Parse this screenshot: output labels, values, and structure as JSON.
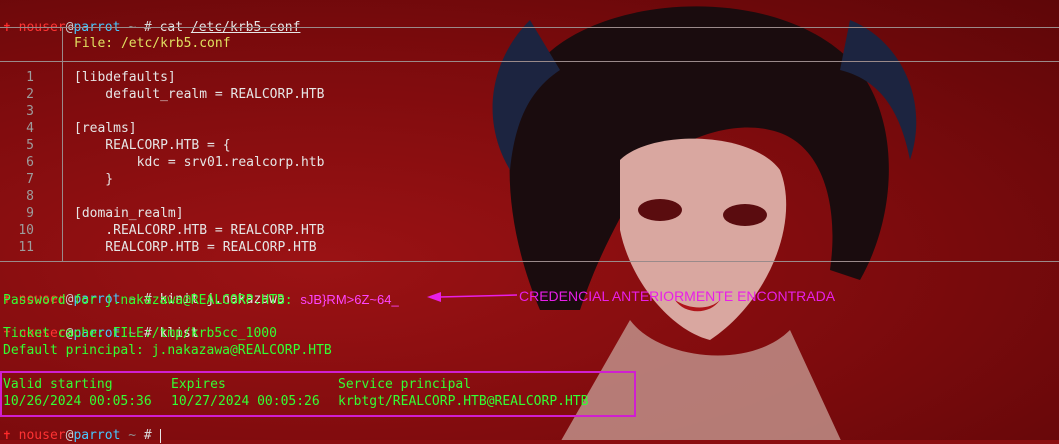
{
  "prompt": {
    "cross": "✝",
    "user": "nouser",
    "at": "@",
    "host": "parrot",
    "path": "~",
    "symbol": "#"
  },
  "commands": {
    "cat": "cat",
    "cat_arg": "/etc/krb5.conf",
    "kinit": "kinit j.nakazawa",
    "klist": "klist"
  },
  "file_header": "File: /etc/krb5.conf",
  "file_lines": [
    {
      "num": "1",
      "text": "[libdefaults]"
    },
    {
      "num": "2",
      "text": "    default_realm = REALCORP.HTB"
    },
    {
      "num": "3",
      "text": ""
    },
    {
      "num": "4",
      "text": "[realms]"
    },
    {
      "num": "5",
      "text": "    REALCORP.HTB = {"
    },
    {
      "num": "6",
      "text": "        kdc = srv01.realcorp.htb"
    },
    {
      "num": "7",
      "text": "    }"
    },
    {
      "num": "8",
      "text": ""
    },
    {
      "num": "9",
      "text": "[domain_realm]"
    },
    {
      "num": "10",
      "text": "    .REALCORP.HTB = REALCORP.HTB"
    },
    {
      "num": "11",
      "text": "    REALCORP.HTB = REALCORP.HTB"
    }
  ],
  "kinit_output": {
    "password_label": "Password for j.nakazawa@REALCORP.HTB:",
    "password_value": "sJB}RM>6Z~64_",
    "annotation": "CREDENCIAL ANTERIORMENTE ENCONTRADA"
  },
  "klist_output": {
    "ticket_cache": "Ticket cache: FILE:/tmp/krb5cc_1000",
    "default_principal": "Default principal: j.nakazawa@REALCORP.HTB",
    "headers": [
      "Valid starting",
      "Expires",
      "Service principal"
    ],
    "row": [
      "10/26/2024 00:05:36",
      "10/27/2024 00:05:26",
      "krbtgt/REALCORP.HTB@REALCORP.HTB"
    ]
  },
  "colors": {
    "background": "#8a0e10",
    "prompt_user": "#ff3333",
    "prompt_host": "#47c8ff",
    "output_green": "#33ff33",
    "annotation_magenta": "#e81fe8"
  }
}
